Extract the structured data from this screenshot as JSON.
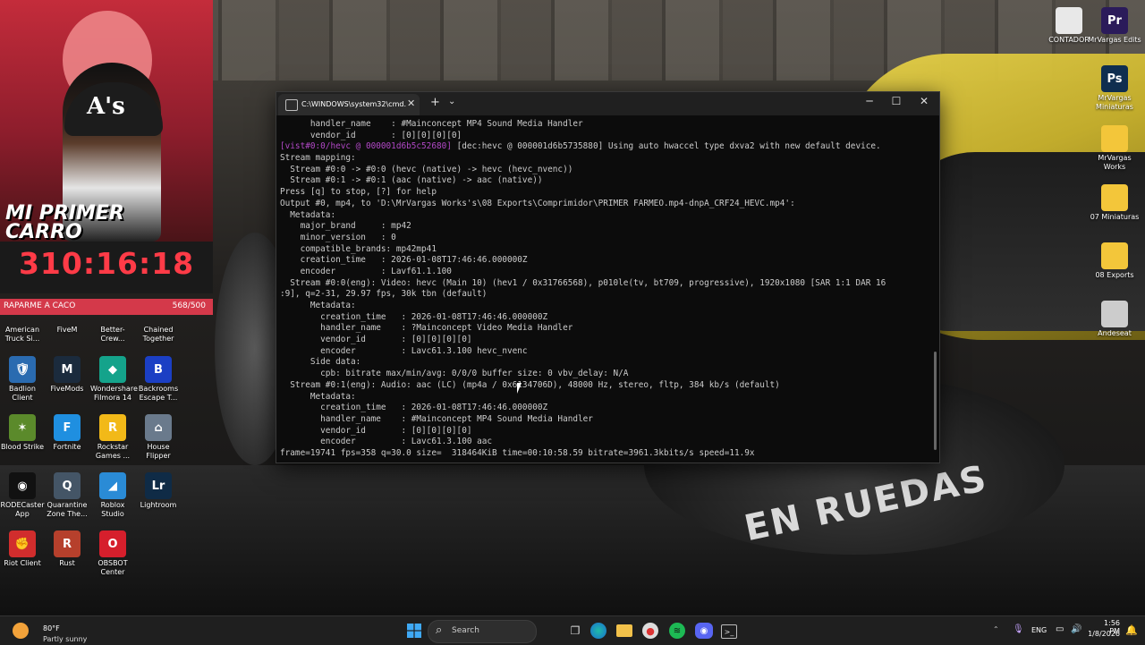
{
  "webcam": {
    "title_line1": "MI PRIMER",
    "title_line2": "CARRO",
    "timer": "310:16:18",
    "goal_label": "RAPARME A CACO",
    "goal_count": "568/500",
    "goal_progress": 1.0
  },
  "desktop_left": [
    {
      "label": "American Truck Si...",
      "icon": "truck-icon",
      "color": "#3a6fb5",
      "glyph": "🚚"
    },
    {
      "label": "FiveM",
      "icon": "fivem-icon",
      "color": "#e2571e",
      "glyph": "F"
    },
    {
      "label": "Better-Crew...",
      "icon": "bettercrew-icon",
      "color": "#3a78c9",
      "glyph": "B"
    },
    {
      "label": "Chained Together",
      "icon": "chained-icon",
      "color": "#7b4a2b",
      "glyph": "C"
    },
    {
      "label": "Badlion Client",
      "icon": "badlion-icon",
      "color": "#2a6bb0",
      "glyph": "🛡"
    },
    {
      "label": "FiveMods",
      "icon": "fivemods-icon",
      "color": "#1b2b3d",
      "glyph": "M"
    },
    {
      "label": "Wondershare Filmora 14",
      "icon": "filmora-icon",
      "color": "#14a38b",
      "glyph": "◆"
    },
    {
      "label": "Backrooms Escape T...",
      "icon": "backrooms-icon",
      "color": "#1b3fc4",
      "glyph": "B"
    },
    {
      "label": "Blood Strike",
      "icon": "bloodstrike-icon",
      "color": "#5b8a2b",
      "glyph": "✶"
    },
    {
      "label": "Fortnite",
      "icon": "fortnite-icon",
      "color": "#1f8fe0",
      "glyph": "F"
    },
    {
      "label": "Rockstar Games ...",
      "icon": "rockstar-icon",
      "color": "#f2b918",
      "glyph": "R"
    },
    {
      "label": "House Flipper",
      "icon": "houseflipper-icon",
      "color": "#6a7a8c",
      "glyph": "⌂"
    },
    {
      "label": "RODECaster App",
      "icon": "rodecaster-icon",
      "color": "#111111",
      "glyph": "◉"
    },
    {
      "label": "Quarantine Zone The...",
      "icon": "quarantine-icon",
      "color": "#445566",
      "glyph": "Q"
    },
    {
      "label": "Roblox Studio",
      "icon": "roblox-icon",
      "color": "#2a8bd6",
      "glyph": "◢"
    },
    {
      "label": "Lightroom",
      "icon": "lightroom-icon",
      "color": "#0f2b46",
      "glyph": "Lr"
    },
    {
      "label": "Riot Client",
      "icon": "riot-icon",
      "color": "#d12d2d",
      "glyph": "✊"
    },
    {
      "label": "Rust",
      "icon": "rust-icon",
      "color": "#b6402c",
      "glyph": "R"
    },
    {
      "label": "OBSBOT Center",
      "icon": "obsbot-icon",
      "color": "#d61f2c",
      "glyph": "O"
    }
  ],
  "desktop_right": [
    {
      "label": "CONTADOR",
      "icon": "file-icon",
      "color": "#e8e8e8",
      "glyph": ""
    },
    {
      "label": "MrVargas Edits",
      "icon": "premiere-icon",
      "color": "#2b1b5a",
      "glyph": "Pr"
    },
    {
      "label": "MrVargas Miniaturas",
      "icon": "photoshop-icon",
      "color": "#0f2e4f",
      "glyph": "Ps"
    },
    {
      "label": "MrVargas Works",
      "icon": "folder-icon",
      "color": "#f3c63a",
      "glyph": ""
    },
    {
      "label": "07 Miniaturas",
      "icon": "folder-icon",
      "color": "#f3c63a",
      "glyph": ""
    },
    {
      "label": "08 Exports",
      "icon": "folder-icon",
      "color": "#f3c63a",
      "glyph": ""
    },
    {
      "label": "Andeseat",
      "icon": "andeseat-icon",
      "color": "#cccccc",
      "glyph": ""
    }
  ],
  "terminal": {
    "tab_title": "C:\\WINDOWS\\system32\\cmd.",
    "lines": [
      {
        "pre": "",
        "mag": "",
        "text": "      handler_name    : #Mainconcept MP4 Sound Media Handler"
      },
      {
        "pre": "",
        "mag": "",
        "text": "      vendor_id       : [0][0][0][0]"
      },
      {
        "pre": "",
        "mag": "[vist#0:0/hevc @ 000001d6b5c52680] ",
        "text": "[dec:hevc @ 000001d6b5735880] Using auto hwaccel type dxva2 with new default device."
      },
      {
        "pre": "",
        "mag": "",
        "text": "Stream mapping:"
      },
      {
        "pre": "",
        "mag": "",
        "text": "  Stream #0:0 -> #0:0 (hevc (native) -> hevc (hevc_nvenc))"
      },
      {
        "pre": "",
        "mag": "",
        "text": "  Stream #0:1 -> #0:1 (aac (native) -> aac (native))"
      },
      {
        "pre": "",
        "mag": "",
        "text": "Press [q] to stop, [?] for help"
      },
      {
        "pre": "",
        "mag": "",
        "text": "Output #0, mp4, to 'D:\\MrVargas Works's\\08 Exports\\Comprimidor\\PRIMER FARMEO.mp4-dnpA_CRF24_HEVC.mp4':"
      },
      {
        "pre": "",
        "mag": "",
        "text": "  Metadata:"
      },
      {
        "pre": "",
        "mag": "",
        "text": "    major_brand     : mp42"
      },
      {
        "pre": "",
        "mag": "",
        "text": "    minor_version   : 0"
      },
      {
        "pre": "",
        "mag": "",
        "text": "    compatible_brands: mp42mp41"
      },
      {
        "pre": "",
        "mag": "",
        "text": "    creation_time   : 2026-01-08T17:46:46.000000Z"
      },
      {
        "pre": "",
        "mag": "",
        "text": "    encoder         : Lavf61.1.100"
      },
      {
        "pre": "",
        "mag": "",
        "text": "  Stream #0:0(eng): Video: hevc (Main 10) (hev1 / 0x31766568), p010le(tv, bt709, progressive), 1920x1080 [SAR 1:1 DAR 16"
      },
      {
        "pre": "",
        "mag": "",
        "text": ":9], q=2-31, 29.97 fps, 30k tbn (default)"
      },
      {
        "pre": "",
        "mag": "",
        "text": "      Metadata:"
      },
      {
        "pre": "",
        "mag": "",
        "text": "        creation_time   : 2026-01-08T17:46:46.000000Z"
      },
      {
        "pre": "",
        "mag": "",
        "text": "        handler_name    : ?Mainconcept Video Media Handler"
      },
      {
        "pre": "",
        "mag": "",
        "text": "        vendor_id       : [0][0][0][0]"
      },
      {
        "pre": "",
        "mag": "",
        "text": "        encoder         : Lavc61.3.100 hevc_nvenc"
      },
      {
        "pre": "",
        "mag": "",
        "text": "      Side data:"
      },
      {
        "pre": "",
        "mag": "",
        "text": "        cpb: bitrate max/min/avg: 0/0/0 buffer size: 0 vbv_delay: N/A"
      },
      {
        "pre": "",
        "mag": "",
        "text": "  Stream #0:1(eng): Audio: aac (LC) (mp4a / 0x6134706D), 48000 Hz, stereo, fltp, 384 kb/s (default)"
      },
      {
        "pre": "",
        "mag": "",
        "text": "      Metadata:"
      },
      {
        "pre": "",
        "mag": "",
        "text": "        creation_time   : 2026-01-08T17:46:46.000000Z"
      },
      {
        "pre": "",
        "mag": "",
        "text": "        handler_name    : #Mainconcept MP4 Sound Media Handler"
      },
      {
        "pre": "",
        "mag": "",
        "text": "        vendor_id       : [0][0][0][0]"
      },
      {
        "pre": "",
        "mag": "",
        "text": "        encoder         : Lavc61.3.100 aac"
      },
      {
        "pre": "",
        "mag": "",
        "text": "frame=19741 fps=358 q=30.0 size=  318464KiB time=00:10:58.59 bitrate=3961.3kbits/s speed=11.9x"
      }
    ]
  },
  "wallpaper": {
    "brand_text": "EN RUEDAS"
  },
  "taskbar": {
    "weather_temp": "80°F",
    "weather_desc": "Partly sunny",
    "search_label": "Search",
    "lang": "ENG",
    "time": "1:56 PM",
    "date": "1/8/2026"
  }
}
